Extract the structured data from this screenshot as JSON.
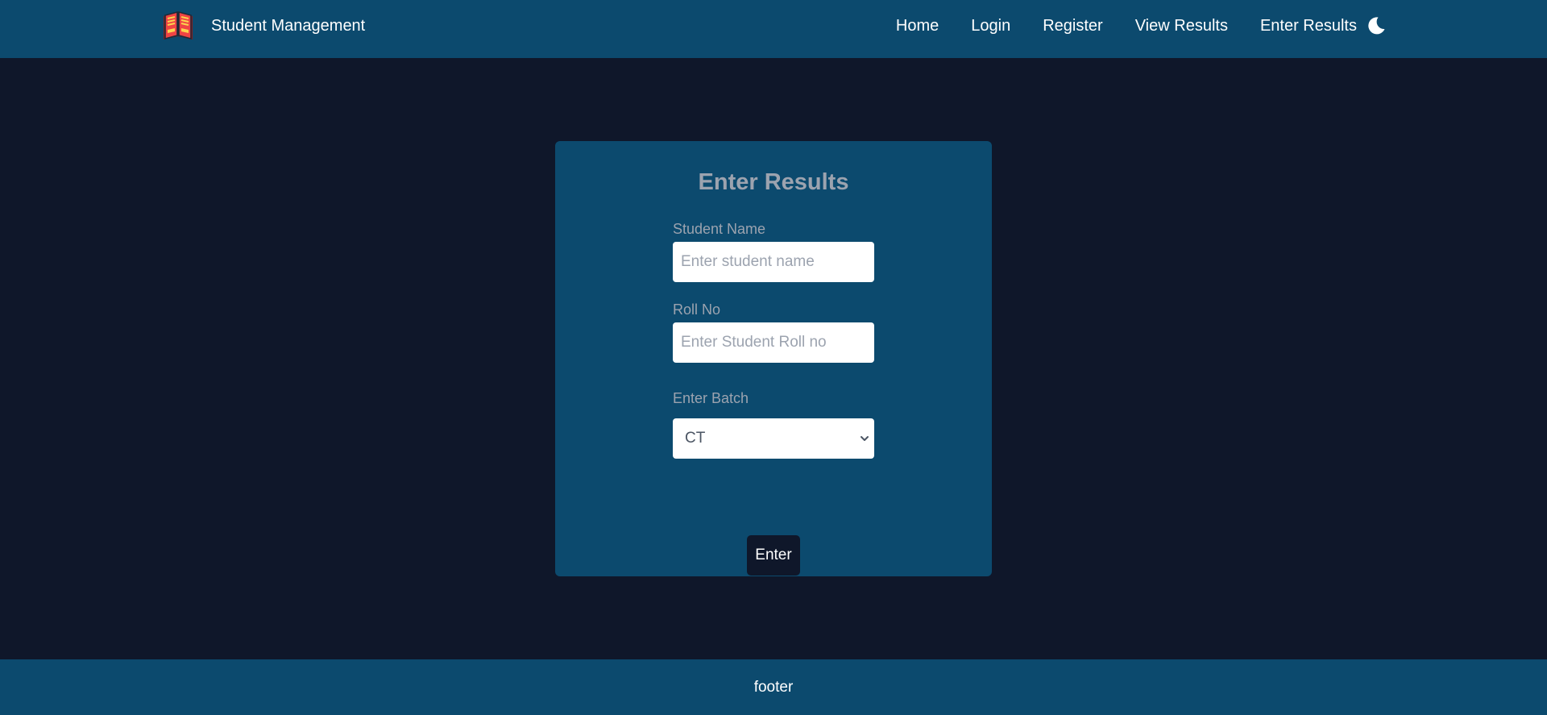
{
  "navbar": {
    "brand_title": "Student Management",
    "logo_icon": "book-icon",
    "links": [
      {
        "label": "Home"
      },
      {
        "label": "Login"
      },
      {
        "label": "Register"
      },
      {
        "label": "View Results"
      },
      {
        "label": "Enter Results"
      }
    ],
    "theme_icon": "moon-icon"
  },
  "form": {
    "title": "Enter Results",
    "student_name": {
      "label": "Student Name",
      "placeholder": "Enter student name",
      "value": ""
    },
    "roll_no": {
      "label": "Roll No",
      "placeholder": "Enter Student Roll no",
      "value": ""
    },
    "batch": {
      "label": "Enter Batch",
      "selected": "CT"
    },
    "submit_label": "Enter"
  },
  "footer": {
    "text": "footer"
  },
  "colors": {
    "background": "#0f172a",
    "panel": "#0c4a6e",
    "muted_text": "#9ca3af",
    "button": "#0f172a"
  }
}
